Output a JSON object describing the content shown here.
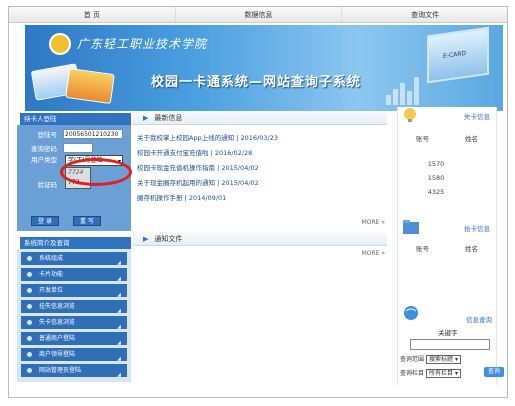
{
  "topnav": [
    "首 页",
    "数据信息",
    "查询文件"
  ],
  "banner": {
    "school": "广东轻工职业技术学院",
    "title": "校园一卡通系统—网站查询子系统",
    "laptop_text": "E-CARD"
  },
  "login": {
    "header": "持卡人登陆",
    "fields": [
      {
        "label": "登陆号",
        "value": "20056501210230"
      },
      {
        "label": "查询密码",
        "value": ""
      },
      {
        "label": "用户类型",
        "value": "学(工)号登陆"
      },
      {
        "label": "验证码",
        "value": ""
      }
    ],
    "captcha_shown": "7724",
    "captcha_value": "773",
    "submit": "登 录",
    "reset": "重 写"
  },
  "menu": {
    "header": "系统简介及查询",
    "items": [
      "系统组成",
      "卡片功能",
      "开发单位",
      "挂失信息浏览",
      "失卡信息浏览",
      "普通商户登陆",
      "商户领导登陆",
      "网站管理员登陆"
    ]
  },
  "news": {
    "header": "最新信息",
    "items": [
      "关于我校掌上校园App上线的通知 | 2016/03/23",
      "校园卡开通支付宝充值啦 | 2016/02/28",
      "校园卡现金充值机操作指南 | 2015/04/02",
      "关于现金圈存机起用的通知 | 2015/04/02",
      "圈存机操作手册 | 2014/09/01"
    ],
    "more": "MORE"
  },
  "notice": {
    "header": "通知文件",
    "more": "MORE"
  },
  "lost_cards": {
    "title": "失卡信息",
    "col_account": "账号",
    "col_name": "姓名",
    "values": [
      "1570",
      "1580",
      "4325"
    ]
  },
  "found_cards": {
    "title": "拾卡信息",
    "col_account": "账号",
    "col_name": "姓名"
  },
  "search": {
    "title": "信息查询",
    "keyword_label": "关键字",
    "range_label": "查询范围",
    "range_value": "搜索标题",
    "column_label": "查询栏目",
    "column_value": "所有栏目",
    "button": "查询"
  }
}
